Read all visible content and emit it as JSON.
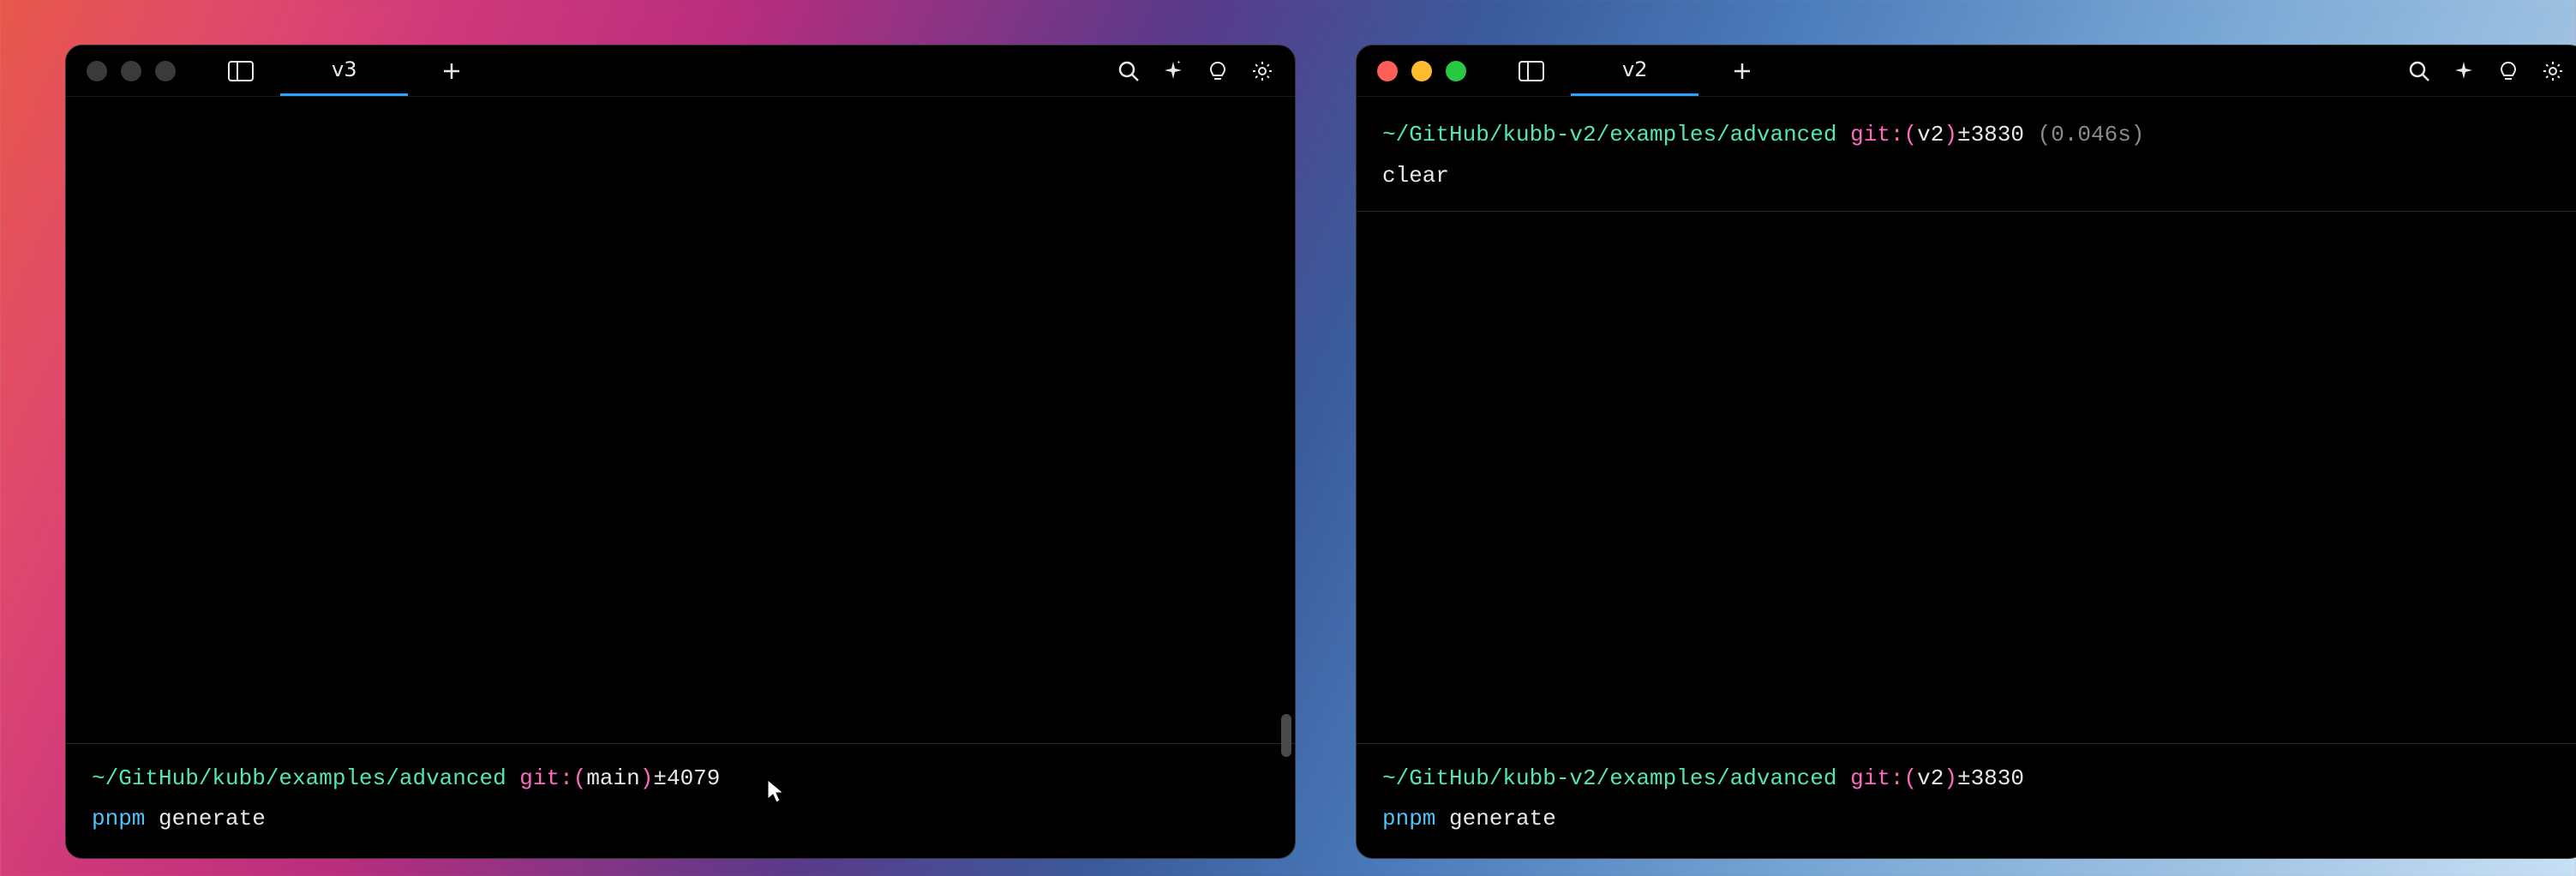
{
  "colors": {
    "accent": "#2aa3ff",
    "prompt_path": "#54e6b0",
    "prompt_git": "#ff6ac1",
    "cmd": "#4fc3f7"
  },
  "left": {
    "tab_title": "v3",
    "traffic_focused": false,
    "prompt": {
      "path": "~/GitHub/kubb/examples/advanced",
      "git_label": "git:",
      "branch_open": "(",
      "branch": "main",
      "branch_close": ")",
      "changes": "±4079",
      "timing": ""
    },
    "command": {
      "part1": "pnpm",
      "part2": "generate"
    }
  },
  "right": {
    "tab_title": "v2",
    "traffic_focused": true,
    "top_prompt": {
      "path": "~/GitHub/kubb-v2/examples/advanced",
      "git_label": "git:",
      "branch_open": "(",
      "branch": "v2",
      "branch_close": ")",
      "changes": "±3830",
      "timing": "(0.046s)"
    },
    "top_command": "clear",
    "prompt": {
      "path": "~/GitHub/kubb-v2/examples/advanced",
      "git_label": "git:",
      "branch_open": "(",
      "branch": "v2",
      "branch_close": ")",
      "changes": "±3830",
      "timing": ""
    },
    "command": {
      "part1": "pnpm",
      "part2": "generate"
    }
  },
  "icons": {
    "panel": "panel-icon",
    "new_tab": "+",
    "search": "search-icon",
    "sparkle": "sparkle-icon",
    "bulb": "bulb-icon",
    "gear": "gear-icon"
  }
}
